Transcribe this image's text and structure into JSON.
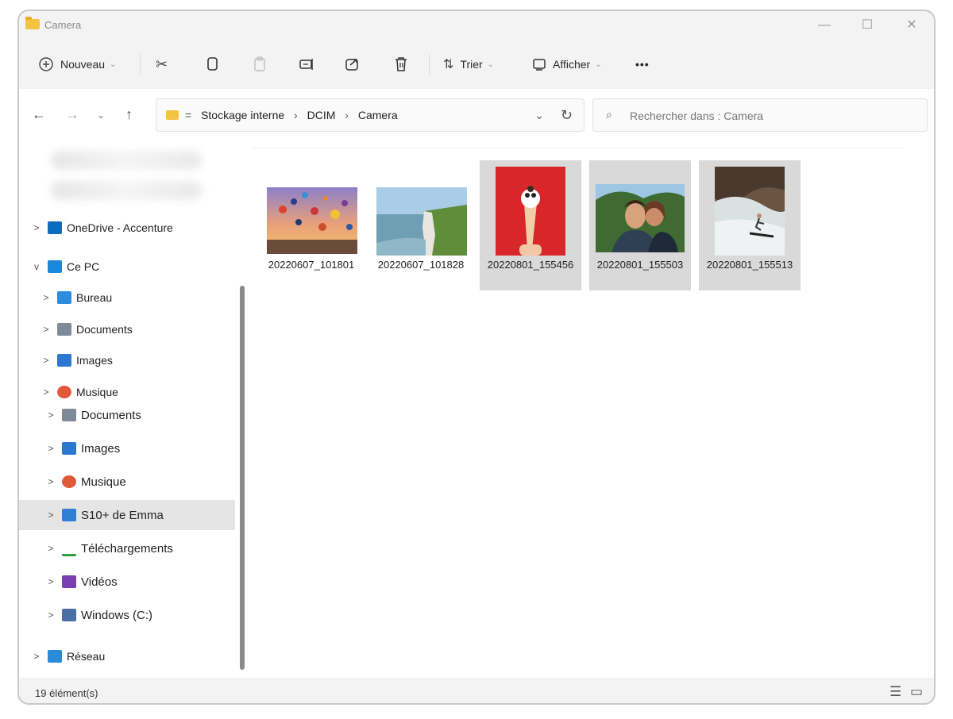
{
  "window": {
    "title": "Camera"
  },
  "window_controls": {
    "minimize": "—",
    "maximize": "☐",
    "close": "✕"
  },
  "toolbar": {
    "new_label": "Nouveau",
    "sort_label": "Trier",
    "view_label": "Afficher",
    "more": "•••"
  },
  "address": {
    "breadcrumbs": [
      "Stockage interne",
      "DCIM",
      "Camera"
    ],
    "search_placeholder": "Rechercher dans : Camera"
  },
  "nav": {
    "items": [
      {
        "label": "OneDrive - Accenture",
        "expander": ">",
        "icon": "onedrive-cloud-icon",
        "color": "#0f6cbd"
      },
      {
        "label": "Ce PC",
        "expander": "v",
        "icon": "pc-monitor-icon",
        "color": "#1e88d8"
      },
      {
        "label": "Bureau",
        "expander": ">",
        "icon": "desktop-icon",
        "color": "#2d8ddc"
      },
      {
        "label": "Documents",
        "expander": ">",
        "icon": "documents-icon",
        "color": "#7e8a98"
      },
      {
        "label": "Images",
        "expander": ">",
        "icon": "images-icon",
        "color": "#2b78d0"
      },
      {
        "label": "Musique",
        "expander": ">",
        "icon": "music-icon",
        "color": "#e05a3a"
      },
      {
        "label": "Documents",
        "expander": ">",
        "icon": "documents-icon",
        "color": "#7e8a98"
      },
      {
        "label": "Images",
        "expander": ">",
        "icon": "images-icon",
        "color": "#2b78d0"
      },
      {
        "label": "Musique",
        "expander": ">",
        "icon": "music-icon",
        "color": "#e05a3a"
      },
      {
        "label": "S10+ de Emma",
        "expander": ">",
        "icon": "phone-icon",
        "color": "#2f7fd4",
        "selected": true
      },
      {
        "label": "Téléchargements",
        "expander": ">",
        "icon": "download-icon",
        "color": "#2f9e44"
      },
      {
        "label": "Vidéos",
        "expander": ">",
        "icon": "videos-icon",
        "color": "#7a3fb0"
      },
      {
        "label": "Windows (C:)",
        "expander": ">",
        "icon": "drive-icon",
        "color": "#4a6fa5"
      },
      {
        "label": "Réseau",
        "expander": ">",
        "icon": "network-icon",
        "color": "#2a8cd8"
      }
    ]
  },
  "files": [
    {
      "name": "20220607_101801",
      "selected": false,
      "thumb": "hot-air-balloons"
    },
    {
      "name": "20220607_101828",
      "selected": false,
      "thumb": "white-cliffs-coast"
    },
    {
      "name": "20220801_155456",
      "selected": true,
      "thumb": "ice-cream-red-background"
    },
    {
      "name": "20220801_155503",
      "selected": true,
      "thumb": "couple-selfie-hiking"
    },
    {
      "name": "20220801_155513",
      "selected": true,
      "thumb": "surfer-wave"
    }
  ],
  "status": {
    "count": "19 élément(s)"
  }
}
